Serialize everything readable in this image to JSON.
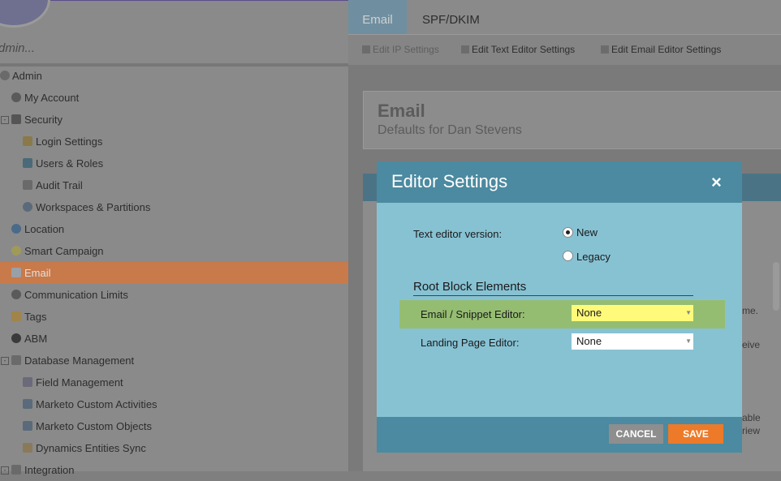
{
  "sidebar": {
    "search_placeholder": "dmin...",
    "items": [
      {
        "label": "Admin"
      },
      {
        "label": "My Account"
      },
      {
        "label": "Security"
      },
      {
        "label": "Login Settings"
      },
      {
        "label": "Users & Roles"
      },
      {
        "label": "Audit Trail"
      },
      {
        "label": "Workspaces & Partitions"
      },
      {
        "label": "Location"
      },
      {
        "label": "Smart Campaign"
      },
      {
        "label": "Email"
      },
      {
        "label": "Communication Limits"
      },
      {
        "label": "Tags"
      },
      {
        "label": "ABM"
      },
      {
        "label": "Database Management"
      },
      {
        "label": "Field Management"
      },
      {
        "label": "Marketo Custom Activities"
      },
      {
        "label": "Marketo Custom Objects"
      },
      {
        "label": "Dynamics Entities Sync"
      },
      {
        "label": "Integration"
      }
    ]
  },
  "tabs": {
    "email": "Email",
    "spf": "SPF/DKIM"
  },
  "toolbar": {
    "ip": "Edit IP Settings",
    "text": "Edit Text Editor Settings",
    "email": "Edit Email Editor Settings"
  },
  "header": {
    "title": "Email",
    "subtitle": "Defaults for Dan Stevens"
  },
  "background_fragments": {
    "f1": "me.",
    "f2": "eive",
    "f3": "able",
    "f4": "riew"
  },
  "modal": {
    "title": "Editor Settings",
    "close": "×",
    "text_editor_label": "Text editor version:",
    "option_new": "New",
    "option_legacy": "Legacy",
    "selected_option": "New",
    "section_title": "Root Block Elements",
    "email_editor_label": "Email / Snippet Editor:",
    "email_editor_value": "None",
    "landing_editor_label": "Landing Page Editor:",
    "landing_editor_value": "None",
    "cancel": "CANCEL",
    "save": "SAVE"
  },
  "colors": {
    "accent": "#ec7a29",
    "modal_header": "#4b8aa0",
    "modal_body": "#87c2d3",
    "highlight": "#95bd72",
    "field_highlight": "#fffa7a"
  }
}
